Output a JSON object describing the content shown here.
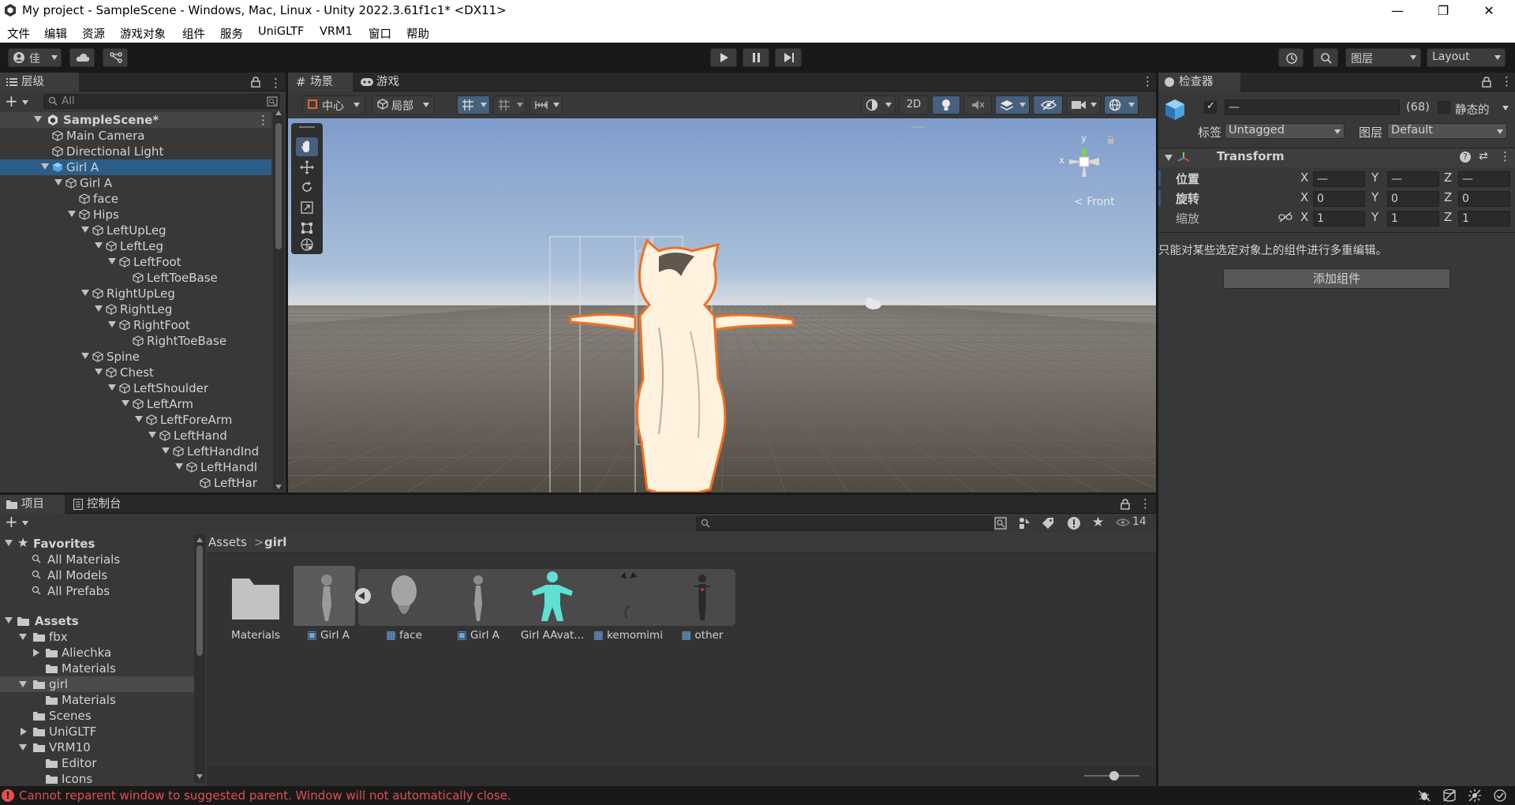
{
  "window": {
    "title": "My project - SampleScene - Windows, Mac, Linux - Unity 2022.3.61f1c1* <DX11>",
    "min_glyph": "—",
    "max_glyph": "❐",
    "close_glyph": "✕"
  },
  "menu": [
    "文件",
    "编辑",
    "资源",
    "游戏对象",
    "组件",
    "服务",
    "UniGLTF",
    "VRM1",
    "窗口",
    "帮助"
  ],
  "toolbar": {
    "account_label": "佳",
    "layers_label": "图层",
    "layout_label": "Layout"
  },
  "hierarchy": {
    "tab_label": "层级",
    "search_placeholder": "All",
    "scene_name": "SampleScene*",
    "items": [
      {
        "label": "Main Camera",
        "indent": 0
      },
      {
        "label": "Directional Light",
        "indent": 0
      },
      {
        "label": "Girl A",
        "indent": 0
      },
      {
        "label": "Girl A",
        "indent": 1
      },
      {
        "label": "face",
        "indent": 2
      },
      {
        "label": "Hips",
        "indent": 2
      },
      {
        "label": "LeftUpLeg",
        "indent": 3
      },
      {
        "label": "LeftLeg",
        "indent": 4
      },
      {
        "label": "LeftFoot",
        "indent": 5
      },
      {
        "label": "LeftToeBase",
        "indent": 6
      },
      {
        "label": "RightUpLeg",
        "indent": 3
      },
      {
        "label": "RightLeg",
        "indent": 4
      },
      {
        "label": "RightFoot",
        "indent": 5
      },
      {
        "label": "RightToeBase",
        "indent": 6
      },
      {
        "label": "Spine",
        "indent": 3
      },
      {
        "label": "Chest",
        "indent": 4
      },
      {
        "label": "LeftShoulder",
        "indent": 5
      },
      {
        "label": "LeftArm",
        "indent": 6
      },
      {
        "label": "LeftForeArm",
        "indent": 7
      },
      {
        "label": "LeftHand",
        "indent": 8
      },
      {
        "label": "LeftHandInd",
        "indent": 9
      },
      {
        "label": "LeftHandI",
        "indent": 10
      },
      {
        "label": "LeftHar",
        "indent": 11
      }
    ]
  },
  "scene_view": {
    "tab_scene": "场景",
    "tab_game": "游戏",
    "pivot_label": "中心",
    "local_label": "局部",
    "mode_2d": "2D",
    "gizmo_front": "Front",
    "gizmo_x": "x",
    "gizmo_y": "y"
  },
  "project": {
    "tab_project": "项目",
    "tab_console": "控制台",
    "hidden_count": "14",
    "favorites_label": "Favorites",
    "favorites": [
      "All Materials",
      "All Models",
      "All Prefabs"
    ],
    "assets_label": "Assets",
    "tree": [
      {
        "label": "fbx",
        "indent": 1
      },
      {
        "label": "Aliechka",
        "indent": 2
      },
      {
        "label": "Materials",
        "indent": 2
      },
      {
        "label": "girl",
        "indent": 1
      },
      {
        "label": "Materials",
        "indent": 2
      },
      {
        "label": "Scenes",
        "indent": 1
      },
      {
        "label": "UniGLTF",
        "indent": 1
      },
      {
        "label": "VRM10",
        "indent": 1
      },
      {
        "label": "Editor",
        "indent": 2
      },
      {
        "label": "Icons",
        "indent": 2
      }
    ],
    "breadcrumb_root": "Assets",
    "breadcrumb_sep": ">",
    "breadcrumb_current": "girl",
    "assets": [
      "Materials",
      "Girl A",
      "face",
      "Girl A",
      "Girl AAvat...",
      "kemomimi",
      "other"
    ]
  },
  "inspector": {
    "tab_label": "检查器",
    "name_value": "—",
    "multi_count": "(68)",
    "static_label": "静态的",
    "tag_label": "标签",
    "tag_value": "Untagged",
    "layer_label": "图层",
    "layer_value": "Default",
    "component_title": "Transform",
    "position_label": "位置",
    "rotation_label": "旋转",
    "scale_label": "缩放",
    "axis_x": "X",
    "axis_y": "Y",
    "axis_z": "Z",
    "position": [
      "—",
      "—",
      "—"
    ],
    "rotation": [
      "0",
      "0",
      "0"
    ],
    "scale": [
      "1",
      "1",
      "1"
    ],
    "multi_edit_note": "只能对某些选定对象上的组件进行多重编辑。",
    "add_component_label": "添加组件"
  },
  "status": {
    "message": "Cannot reparent window to suggested parent. Window will not automatically close."
  },
  "colors": {
    "accent": "#2c5d87",
    "error": "#e05050",
    "outline": "#f07020",
    "teal": "#5fe0d2"
  }
}
